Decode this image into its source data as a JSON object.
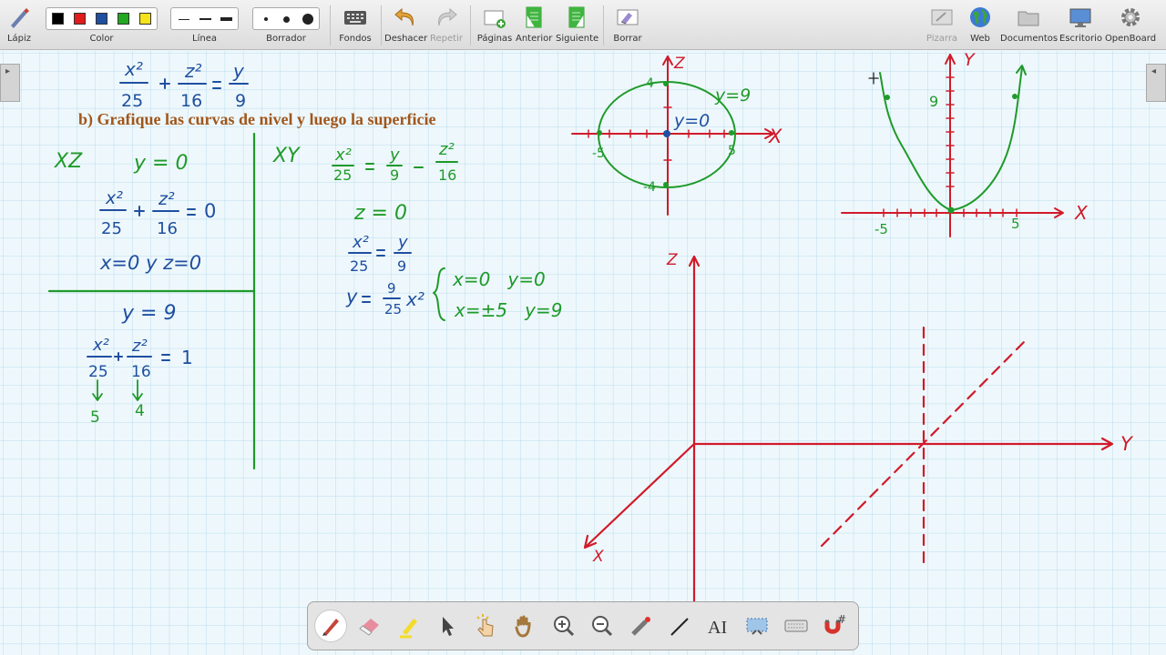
{
  "toolbar": {
    "pen": {
      "label": "Lápiz",
      "icon": "pen-icon"
    },
    "color": {
      "label": "Color",
      "swatches": [
        "#000000",
        "#e01c1c",
        "#1f4fa0",
        "#23a823",
        "#f5e31b"
      ]
    },
    "line": {
      "label": "Línea"
    },
    "eraser": {
      "label": "Borrador"
    },
    "backgrounds": {
      "label": "Fondos",
      "icon": "keyboard-icon"
    },
    "undo": {
      "label": "Deshacer",
      "icon": "undo-icon"
    },
    "redo": {
      "label": "Repetir",
      "icon": "redo-icon",
      "disabled": true
    },
    "pages": {
      "label": "Páginas",
      "icon": "add-page-icon"
    },
    "previous": {
      "label": "Anterior",
      "icon": "previous-page-icon"
    },
    "next": {
      "label": "Siguiente",
      "icon": "next-page-icon"
    },
    "clear": {
      "label": "Borrar",
      "icon": "clear-page-icon"
    },
    "board": {
      "label": "Pizarra",
      "icon": "board-icon",
      "disabled": true
    },
    "web": {
      "label": "Web",
      "icon": "globe-icon"
    },
    "documents": {
      "label": "Documentos",
      "icon": "folder-icon"
    },
    "desktop": {
      "label": "Escritorio",
      "icon": "monitor-icon"
    },
    "openboard": {
      "label": "OpenBoard",
      "icon": "gear-icon"
    }
  },
  "board": {
    "heading": "b) Grafique las curvas de nivel y luego la superficie",
    "ink": {
      "section_xz": "XZ",
      "section_xy": "XY",
      "cond_y0": "y = 0",
      "cond_y9": "y = 9",
      "cond_z0": "z = 0",
      "solution_xz": "x=0 y z=0",
      "solution_a": "x=0   y=0",
      "solution_b": "x=±5   y=9",
      "arrow_value_a": "5",
      "arrow_value_b": "4",
      "ellipse_label_y9": "y=9",
      "ellipse_label_y0": "y=0",
      "ellipse_tick_z_pos": "4",
      "ellipse_tick_z_neg": "-4",
      "ellipse_tick_x_neg": "-5",
      "ellipse_tick_x_pos": "5",
      "parabola_tick_y": "9",
      "parabola_tick_x_neg": "-5",
      "parabola_tick_x_pos": "5",
      "axis_x": "X",
      "axis_y": "Y",
      "axis_z": "Z",
      "axis3d_x": "X",
      "axis3d_y": "Y",
      "axis3d_z": "Z"
    }
  },
  "dock": {
    "tools": [
      "pen-icon",
      "eraser-icon",
      "highlighter-icon",
      "pointer-icon",
      "interact-icon",
      "hand-icon",
      "zoom-in-icon",
      "zoom-out-icon",
      "laser-pointer-icon",
      "line-icon",
      "text-icon",
      "capture-icon",
      "virtual-keyboard-icon",
      "magnet-icon"
    ],
    "active": "pen-icon"
  },
  "colors": {
    "ink_blue": "#1f4fa0",
    "ink_green": "#1f9a2a",
    "ink_red": "#d11a2a",
    "heading": "#a0561b",
    "grid": "#b9dcec"
  }
}
